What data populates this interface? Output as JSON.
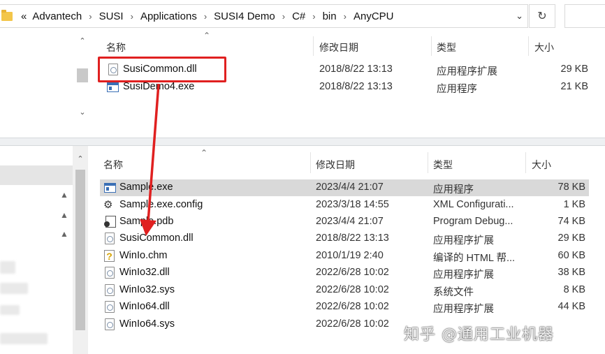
{
  "address_bar": {
    "overflow_chevron": "«",
    "crumbs": [
      "Advantech",
      "SUSI",
      "Applications",
      "SUSI4 Demo",
      "C#",
      "bin",
      "AnyCPU"
    ],
    "separator": "›",
    "dropdown_icon": "chevron-down-icon",
    "refresh_icon": "refresh-icon"
  },
  "columns": {
    "name": "名称",
    "modified": "修改日期",
    "type": "类型",
    "size": "大小"
  },
  "top_files": [
    {
      "name": "SusiCommon.dll",
      "modified": "2018/8/22 13:13",
      "type": "应用程序扩展",
      "size": "29 KB",
      "icon": "dll-file-icon"
    },
    {
      "name": "SusiDemo4.exe",
      "modified": "2018/8/22 13:13",
      "type": "应用程序",
      "size": "21 KB",
      "icon": "exe-file-icon"
    }
  ],
  "bottom_files": [
    {
      "name": "Sample.exe",
      "modified": "2023/4/4 21:07",
      "type": "应用程序",
      "size": "78 KB",
      "icon": "exe-file-icon",
      "selected": true
    },
    {
      "name": "Sample.exe.config",
      "modified": "2023/3/18 14:55",
      "type": "XML Configurati...",
      "size": "1 KB",
      "icon": "config-file-icon"
    },
    {
      "name": "Sample.pdb",
      "modified": "2023/4/4 21:07",
      "type": "Program Debug...",
      "size": "74 KB",
      "icon": "pdb-file-icon"
    },
    {
      "name": "SusiCommon.dll",
      "modified": "2018/8/22 13:13",
      "type": "应用程序扩展",
      "size": "29 KB",
      "icon": "dll-file-icon"
    },
    {
      "name": "WinIo.chm",
      "modified": "2010/1/19 2:40",
      "type": "编译的 HTML 帮...",
      "size": "60 KB",
      "icon": "chm-file-icon"
    },
    {
      "name": "WinIo32.dll",
      "modified": "2022/6/28 10:02",
      "type": "应用程序扩展",
      "size": "38 KB",
      "icon": "dll-file-icon"
    },
    {
      "name": "WinIo32.sys",
      "modified": "2022/6/28 10:02",
      "type": "系统文件",
      "size": "8 KB",
      "icon": "sys-file-icon"
    },
    {
      "name": "WinIo64.dll",
      "modified": "2022/6/28 10:02",
      "type": "应用程序扩展",
      "size": "44 KB",
      "icon": "dll-file-icon"
    },
    {
      "name": "WinIo64.sys",
      "modified": "2022/6/28 10:02",
      "type": "系统文件",
      "size": "",
      "icon": "sys-file-icon"
    }
  ],
  "watermark": "知乎 @通用工业机器",
  "colors": {
    "highlight": "#e02020",
    "selected_row": "#d9d9d9"
  }
}
